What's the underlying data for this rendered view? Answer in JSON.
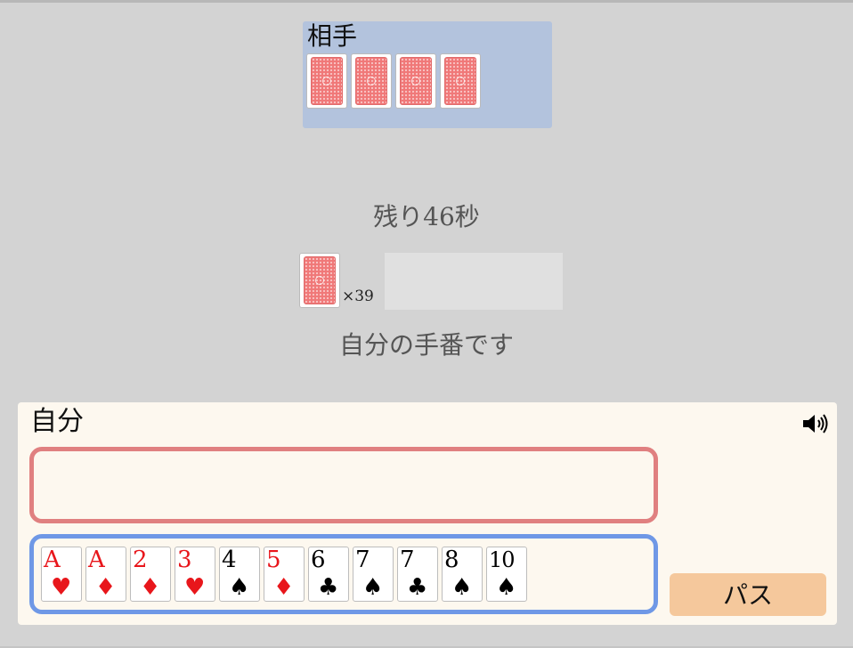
{
  "opponent": {
    "label": "相手",
    "card_count": 4
  },
  "timer": {
    "text": "残り46秒"
  },
  "deck": {
    "count_text": "×39"
  },
  "turn_message": "自分の手番です",
  "player": {
    "label": "自分",
    "hand": [
      {
        "rank": "A",
        "suit": "♥",
        "color": "red"
      },
      {
        "rank": "A",
        "suit": "♦",
        "color": "red"
      },
      {
        "rank": "2",
        "suit": "♦",
        "color": "red"
      },
      {
        "rank": "3",
        "suit": "♥",
        "color": "red"
      },
      {
        "rank": "4",
        "suit": "♠",
        "color": "black"
      },
      {
        "rank": "5",
        "suit": "♦",
        "color": "red"
      },
      {
        "rank": "6",
        "suit": "♣",
        "color": "black"
      },
      {
        "rank": "7",
        "suit": "♠",
        "color": "black"
      },
      {
        "rank": "7",
        "suit": "♣",
        "color": "black"
      },
      {
        "rank": "8",
        "suit": "♠",
        "color": "black"
      },
      {
        "rank": "10",
        "suit": "♠",
        "color": "black"
      }
    ]
  },
  "buttons": {
    "pass_label": "パス"
  },
  "icons": {
    "sound": "speaker-icon"
  },
  "colors": {
    "background": "#d3d3d3",
    "opponent_panel": "#b3c3dd",
    "player_panel": "#fdf8ef",
    "play_area_border": "#e08080",
    "hand_area_border": "#6f98e6",
    "pass_button": "#f5c89c",
    "red_suit": "#e8161b"
  }
}
